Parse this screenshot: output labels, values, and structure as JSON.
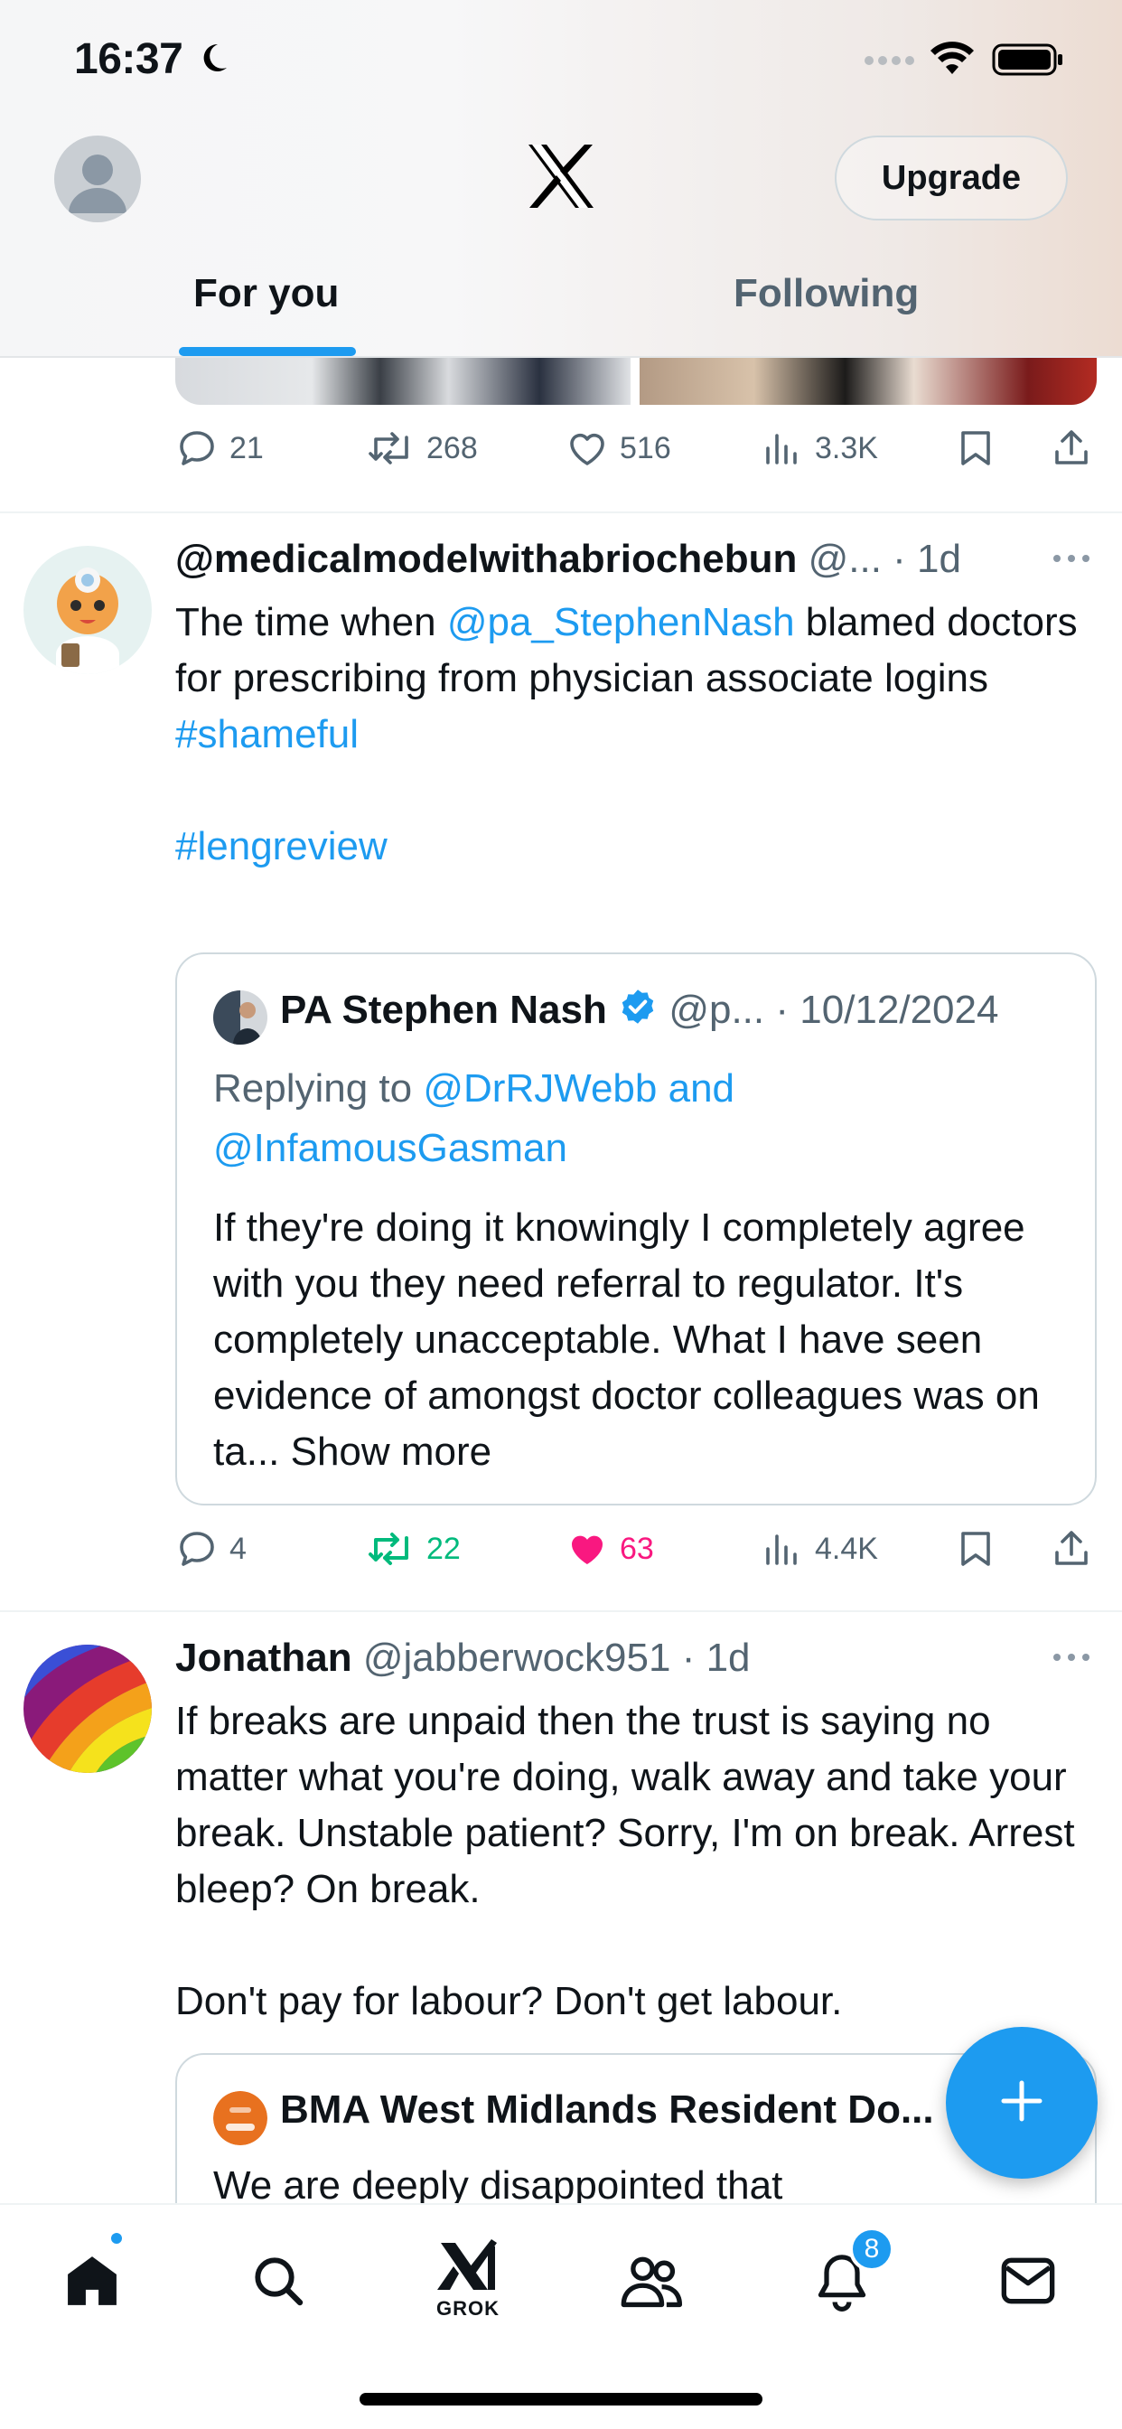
{
  "status": {
    "time": "16:37"
  },
  "header": {
    "upgrade_label": "Upgrade"
  },
  "tabs": [
    {
      "label": "For you",
      "active": true
    },
    {
      "label": "Following",
      "active": false
    }
  ],
  "prev_post": {
    "stats": {
      "replies": "21",
      "reposts": "268",
      "likes": "516",
      "views": "3.3K"
    }
  },
  "post1": {
    "name": "@medicalmodelwithabriochebun",
    "handle": "@...",
    "sep": "·",
    "time": "1d",
    "text": {
      "t1": "The time when ",
      "mention": "@pa_StephenNash",
      "t2": " blamed doctors for prescribing from physician associate logins",
      "tag1": "#shameful",
      "tag2": "#lengreview"
    },
    "quote": {
      "name": "PA Stephen Nash",
      "handle": "@p...",
      "sep": "·",
      "time": "10/12/2024",
      "replying_prefix": "Replying to ",
      "replying_users": "@DrRJWebb and @InfamousGasman",
      "text": "If they're doing it knowingly I completely agree with you they need referral to regulator. It's completely unacceptable. What I have seen evidence of amongst doctor colleagues was on ta...",
      "show_more": "Show more"
    },
    "stats": {
      "replies": "4",
      "reposts": "22",
      "likes": "63",
      "views": "4.4K"
    }
  },
  "post2": {
    "name": "Jonathan",
    "handle": "@jabberwock951",
    "sep": "·",
    "time": "1d",
    "text1": "If breaks are unpaid then the trust is saying no matter what you're doing, walk away and take your break. Unstable patient? Sorry, I'm on break. Arrest bleep? On break.",
    "text2": "Don't pay for labour? Don't get labour.",
    "quote": {
      "name": "BMA West Midlands Resident Do...",
      "text": "We are deeply disappointed that"
    }
  },
  "nav": {
    "grok_label": "GROK",
    "notifications_badge": "8"
  },
  "colors": {
    "accent": "#1d9bf0",
    "repost_active": "#00ba7c",
    "like_active": "#f91880",
    "muted": "#536471"
  },
  "icons": [
    "moon-icon",
    "signal-icon",
    "wifi-icon",
    "battery-icon",
    "x-logo-icon",
    "reply-icon",
    "repost-icon",
    "like-icon",
    "views-icon",
    "bookmark-icon",
    "share-icon",
    "more-icon",
    "verified-icon",
    "compose-icon",
    "home-icon",
    "search-icon",
    "grok-icon",
    "communities-icon",
    "notifications-icon",
    "messages-icon"
  ]
}
